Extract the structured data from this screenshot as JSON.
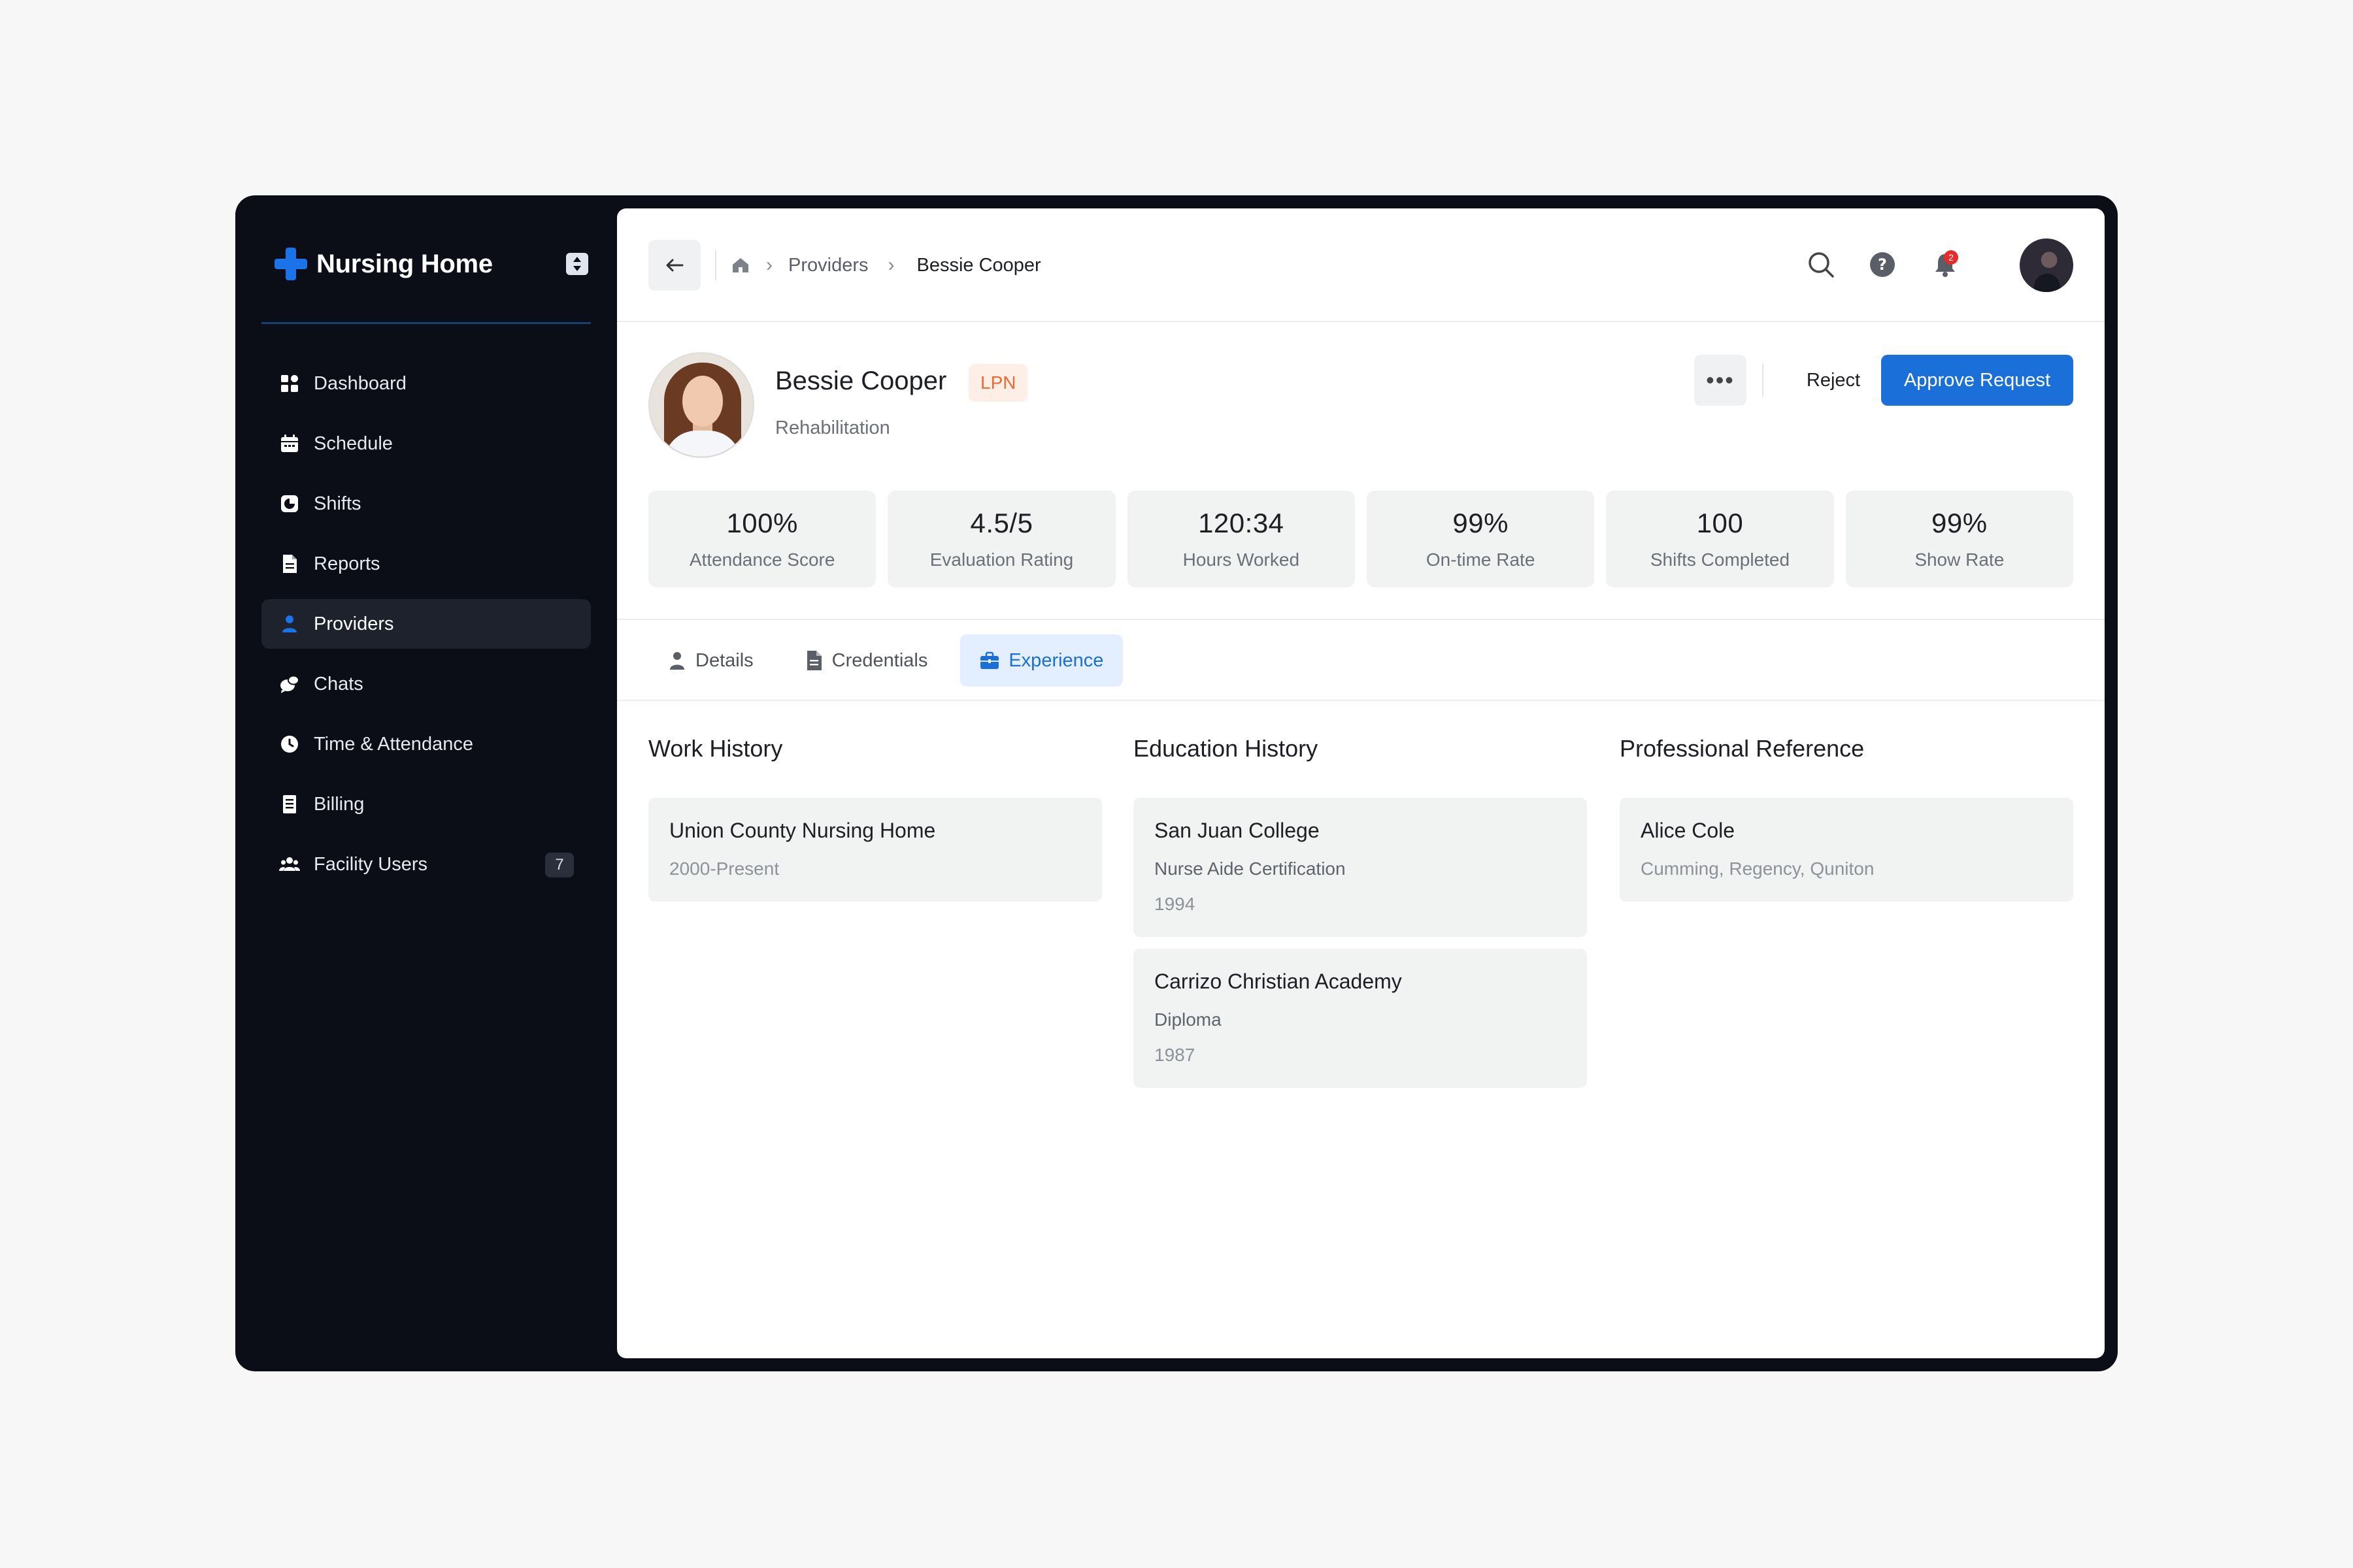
{
  "app": {
    "brand": "Nursing Home",
    "accent_color": "#1a73e8",
    "sidebar_bg": "#0b0e17"
  },
  "sidebar": {
    "items": [
      {
        "label": "Dashboard",
        "icon": "grid-icon"
      },
      {
        "label": "Schedule",
        "icon": "calendar-icon"
      },
      {
        "label": "Shifts",
        "icon": "shifts-icon"
      },
      {
        "label": "Reports",
        "icon": "document-icon"
      },
      {
        "label": "Providers",
        "icon": "user-icon",
        "active": true
      },
      {
        "label": "Chats",
        "icon": "chat-icon"
      },
      {
        "label": "Time & Attendance",
        "icon": "clock-icon"
      },
      {
        "label": "Billing",
        "icon": "receipt-icon"
      },
      {
        "label": "Facility Users",
        "icon": "users-icon",
        "badge": "7"
      }
    ]
  },
  "breadcrumb": {
    "items": [
      "Providers",
      "Bessie Cooper"
    ]
  },
  "header": {
    "notification_count": "2"
  },
  "profile": {
    "name": "Bessie Cooper",
    "role": "LPN",
    "department": "Rehabilitation",
    "actions": {
      "reject": "Reject",
      "approve": "Approve Request"
    }
  },
  "stats": [
    {
      "value": "100%",
      "label": "Attendance Score"
    },
    {
      "value": "4.5/5",
      "label": "Evaluation Rating"
    },
    {
      "value": "120:34",
      "label": "Hours Worked"
    },
    {
      "value": "99%",
      "label": "On-time Rate"
    },
    {
      "value": "100",
      "label": "Shifts Completed"
    },
    {
      "value": "99%",
      "label": "Show Rate"
    }
  ],
  "tabs": [
    {
      "label": "Details",
      "icon": "user-icon"
    },
    {
      "label": "Credentials",
      "icon": "document-icon"
    },
    {
      "label": "Experience",
      "icon": "briefcase-icon",
      "active": true
    }
  ],
  "experience": {
    "work_history": {
      "title": "Work History",
      "items": [
        {
          "title": "Union County Nursing Home",
          "meta": "2000-Present"
        }
      ]
    },
    "education_history": {
      "title": "Education History",
      "items": [
        {
          "title": "San Juan College",
          "sub": "Nurse Aide Certification",
          "meta": "1994"
        },
        {
          "title": "Carrizo Christian Academy",
          "sub": "Diploma",
          "meta": "1987"
        }
      ]
    },
    "professional_reference": {
      "title": "Professional Reference",
      "items": [
        {
          "title": "Alice Cole",
          "meta": "Cumming, Regency, Quniton"
        }
      ]
    }
  }
}
